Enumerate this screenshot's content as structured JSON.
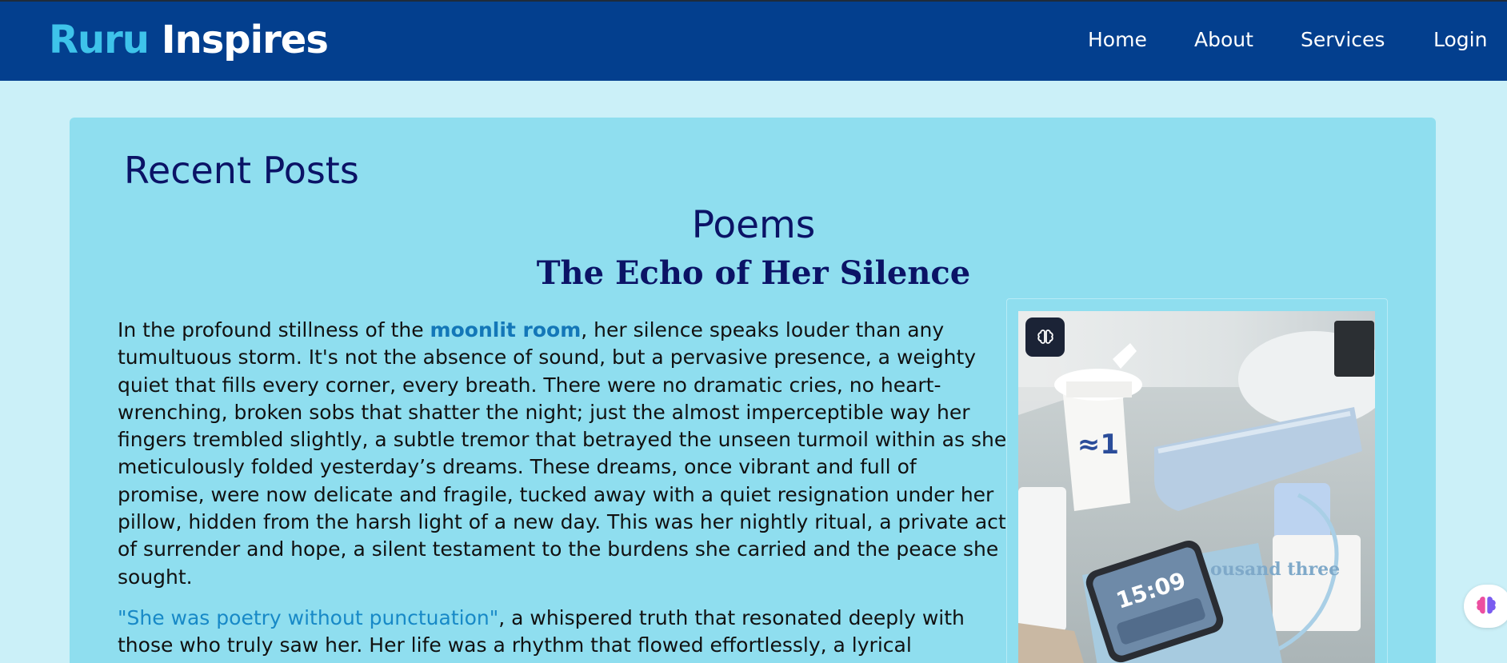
{
  "header": {
    "brand_part1": "Ruru",
    "brand_part2": "Inspires",
    "nav": [
      {
        "label": "Home"
      },
      {
        "label": "About"
      },
      {
        "label": "Services"
      },
      {
        "label": "Login"
      }
    ]
  },
  "main": {
    "section_title": "Recent Posts",
    "category": "Poems",
    "post": {
      "title": "The Echo of Her Silence",
      "p1_before": "In the profound stillness of the ",
      "p1_highlight": "moonlit room",
      "p1_after": ", her silence speaks louder than any tumultuous storm. It's not the absence of sound, but a pervasive presence, a weighty quiet that fills every corner, every breath. There were no dramatic cries, no heart-wrenching, broken sobs that shatter the night; just the almost imperceptible way her fingers trembled slightly, a subtle tremor that betrayed the unseen turmoil within as she meticulously folded yesterday’s dreams. These dreams, once vibrant and full of promise, were now delicate and fragile, tucked away with a quiet resignation under her pillow, hidden from the harsh light of a new day. This was her nightly ritual, a private act of surrender and hope, a silent testament to the burdens she carried and the peace she sought.",
      "p2_quote": "\"She was poetry without punctuation\"",
      "p2_after": ", a whispered truth that resonated deeply with those who truly saw her. Her life was a rhythm that flowed effortlessly, a lyrical"
    },
    "image": {
      "cup_text": "≈1",
      "phone_time": "15:09",
      "book_text": "ousand three"
    }
  },
  "colors": {
    "navbar": "#033f8e",
    "page_bg": "#cbf0f8",
    "card_bg": "#8fdeef",
    "heading": "#0b1366",
    "link": "#1377b8",
    "brand_accent": "#3ec3ea"
  },
  "icons": {
    "image_badge": "brain-icon",
    "floating_button": "brain-icon"
  }
}
